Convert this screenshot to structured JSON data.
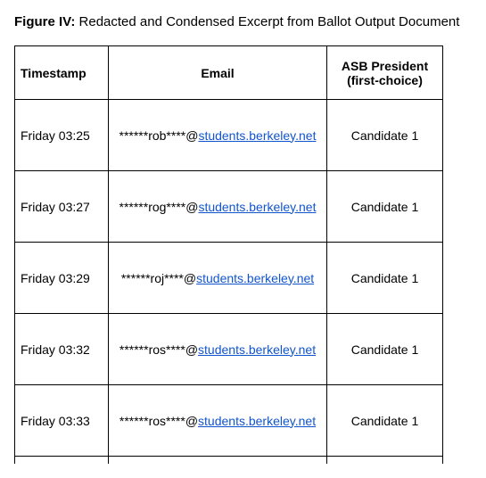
{
  "figure": {
    "label": "Figure IV:",
    "caption": "Redacted and Condensed Excerpt from Ballot Output Document"
  },
  "table": {
    "headers": {
      "timestamp": "Timestamp",
      "email": "Email",
      "president": "ASB President (first-choice)"
    },
    "email_domain": "students.berkeley.net",
    "rows": [
      {
        "timestamp": "Friday 03:25",
        "email_prefix": "******rob****@",
        "president": "Candidate 1"
      },
      {
        "timestamp": "Friday 03:27",
        "email_prefix": "******rog****@",
        "president": "Candidate 1"
      },
      {
        "timestamp": "Friday 03:29",
        "email_prefix": "******roj****@",
        "president": "Candidate 1"
      },
      {
        "timestamp": "Friday 03:32",
        "email_prefix": "******ros****@",
        "president": "Candidate 1"
      },
      {
        "timestamp": "Friday 03:33",
        "email_prefix": "******ros****@",
        "president": "Candidate 1"
      }
    ]
  }
}
